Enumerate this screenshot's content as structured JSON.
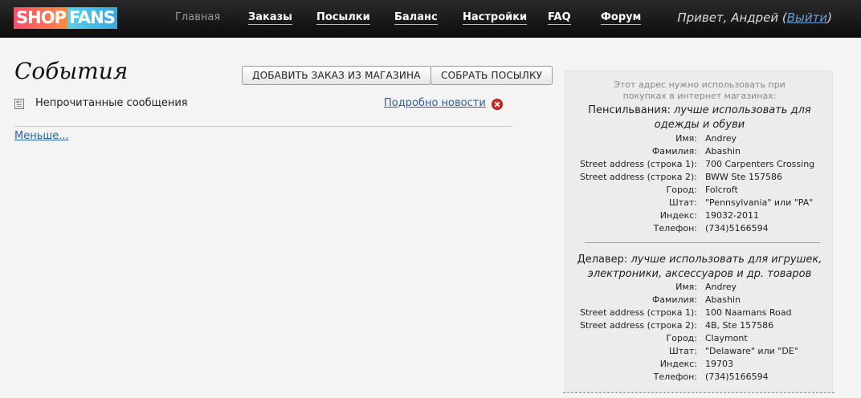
{
  "logo": {
    "part1": "SHOP",
    "part2": "FANS"
  },
  "nav": {
    "items": [
      {
        "label": "Главная"
      },
      {
        "label": "Заказы"
      },
      {
        "label": "Посылки"
      },
      {
        "label": "Баланс"
      },
      {
        "label": "Настройки"
      },
      {
        "label": "FAQ"
      },
      {
        "label": "Форум"
      }
    ],
    "greeting": "Привет, Андрей (",
    "logout": "Выйти",
    "greeting_end": ")"
  },
  "main": {
    "title": "События",
    "add_order_button": "ДОБАВИТЬ ЗАКАЗ ИЗ МАГАЗИНА",
    "collect_parcel_button": "СОБРАТЬ ПОСЫЛКУ",
    "unread_label": "Непрочитанные сообщения",
    "more_news_link": "Подробно новости",
    "less_link": "Меньше..."
  },
  "panel": {
    "note_line1": "Этот адрес нужно использовать при",
    "note_line2": "покупках в интернет магазинах:",
    "addresses": [
      {
        "state": "Пенсильвания:",
        "hint1": "лучше использовать для",
        "hint2": "одежды и обуви",
        "fields": [
          {
            "label": "Имя:",
            "value": "Andrey"
          },
          {
            "label": "Фамилия:",
            "value": "Abashin"
          },
          {
            "label": "Street address (строка 1):",
            "value": "700 Carpenters Crossing"
          },
          {
            "label": "Street address (строка 2):",
            "value": "BWW Ste 157586"
          },
          {
            "label": "Город:",
            "value": "Folcroft"
          },
          {
            "label": "Штат:",
            "value": "\"Pennsylvania\" или \"PA\""
          },
          {
            "label": "Индекс:",
            "value": "19032-2011"
          },
          {
            "label": "Телефон:",
            "value": "(734)5166594"
          }
        ]
      },
      {
        "state": "Делавер:",
        "hint1": "лучше использовать для игрушек,",
        "hint2": "электроники, аксессуаров и др. товаров",
        "fields": [
          {
            "label": "Имя:",
            "value": "Andrey"
          },
          {
            "label": "Фамилия:",
            "value": "Abashin"
          },
          {
            "label": "Street address (строка 1):",
            "value": "100 Naamans Road"
          },
          {
            "label": "Street address (строка 2):",
            "value": "4B, Ste 157586"
          },
          {
            "label": "Город:",
            "value": "Claymont"
          },
          {
            "label": "Штат:",
            "value": "\"Delaware\" или \"DE\""
          },
          {
            "label": "Индекс:",
            "value": "19703"
          },
          {
            "label": "Телефон:",
            "value": "(734)5166594"
          }
        ]
      }
    ]
  },
  "colors": {
    "link": "#2a5fa6",
    "topbar": "#141414",
    "close": "#d9262b"
  }
}
